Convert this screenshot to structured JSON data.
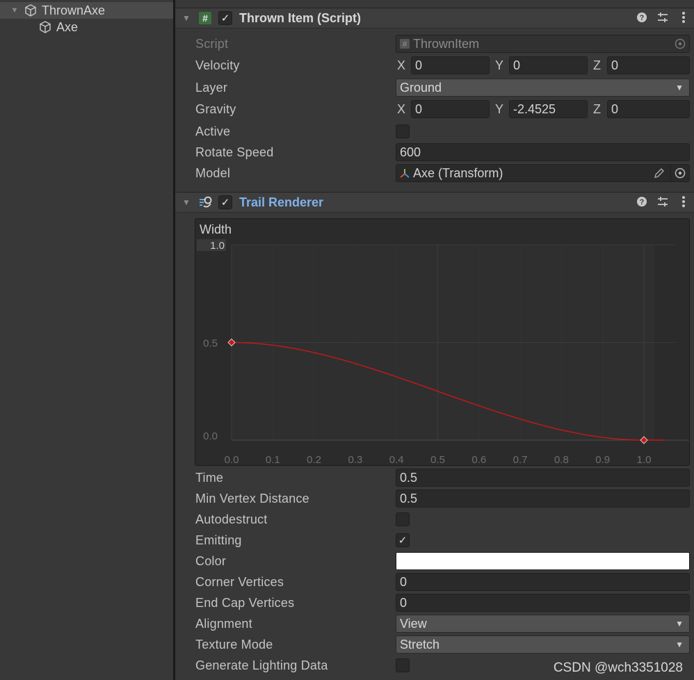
{
  "hierarchy": {
    "items": [
      {
        "label": "ThrownAxe",
        "expanded": true,
        "selected": true,
        "icon": "cube-icon"
      },
      {
        "label": "Axe",
        "expanded": false,
        "selected": false,
        "icon": "cube-icon"
      }
    ]
  },
  "thrown_item": {
    "title": "Thrown Item (Script)",
    "enabled": true,
    "icon": "script-hash-icon",
    "fields": {
      "script": {
        "label": "Script",
        "value": "ThrownItem"
      },
      "velocity": {
        "label": "Velocity",
        "x": "0",
        "y": "0",
        "z": "0"
      },
      "layer": {
        "label": "Layer",
        "value": "Ground"
      },
      "gravity": {
        "label": "Gravity",
        "x": "0",
        "y": "-2.4525",
        "z": "0"
      },
      "active": {
        "label": "Active",
        "checked": false
      },
      "rotate_speed": {
        "label": "Rotate Speed",
        "value": "600"
      },
      "model": {
        "label": "Model",
        "value": "Axe (Transform)"
      }
    },
    "axis_labels": {
      "x": "X",
      "y": "Y",
      "z": "Z"
    }
  },
  "trail_renderer": {
    "title": "Trail Renderer",
    "enabled": true,
    "icon": "trail-renderer-icon",
    "width_curve": {
      "label": "Width",
      "y_ticks": [
        "1.0",
        "0.5",
        "0.0"
      ],
      "x_ticks": [
        "0.0",
        "0.1",
        "0.2",
        "0.3",
        "0.4",
        "0.5",
        "0.6",
        "0.7",
        "0.8",
        "0.9",
        "1.0"
      ],
      "keys": [
        {
          "time": 0.0,
          "value": 0.5
        },
        {
          "time": 1.0,
          "value": 0.0
        }
      ],
      "curve_color": "#c81818"
    },
    "fields": {
      "time": {
        "label": "Time",
        "value": "0.5"
      },
      "min_vertex_distance": {
        "label": "Min Vertex Distance",
        "value": "0.5"
      },
      "autodestruct": {
        "label": "Autodestruct",
        "checked": false
      },
      "emitting": {
        "label": "Emitting",
        "checked": true
      },
      "color": {
        "label": "Color",
        "value": "#ffffff"
      },
      "corner_vertices": {
        "label": "Corner Vertices",
        "value": "0"
      },
      "end_cap_vertices": {
        "label": "End Cap Vertices",
        "value": "0"
      },
      "alignment": {
        "label": "Alignment",
        "value": "View"
      },
      "texture_mode": {
        "label": "Texture Mode",
        "value": "Stretch"
      },
      "generate_lighting_data": {
        "label": "Generate Lighting Data",
        "checked": false
      }
    }
  },
  "watermark": "CSDN @wch3351028"
}
